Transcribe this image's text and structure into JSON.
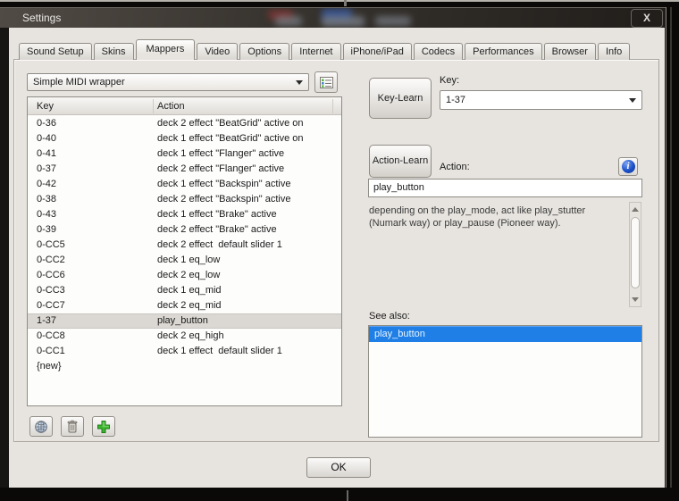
{
  "window": {
    "title": "Settings",
    "close_label": "X"
  },
  "tabs": [
    {
      "label": "Sound Setup"
    },
    {
      "label": "Skins"
    },
    {
      "label": "Mappers",
      "active": true
    },
    {
      "label": "Video"
    },
    {
      "label": "Options"
    },
    {
      "label": "Internet"
    },
    {
      "label": "iPhone/iPad"
    },
    {
      "label": "Codecs"
    },
    {
      "label": "Performances"
    },
    {
      "label": "Browser"
    },
    {
      "label": "Info"
    }
  ],
  "mapper": {
    "selected": "Simple MIDI wrapper"
  },
  "mapping_table": {
    "columns": [
      "Key",
      "Action"
    ],
    "rows": [
      {
        "key": "0-36",
        "action": "deck 2 effect \"BeatGrid\" active on"
      },
      {
        "key": "0-40",
        "action": "deck 1 effect \"BeatGrid\" active on"
      },
      {
        "key": "0-41",
        "action": "deck 1 effect \"Flanger\" active"
      },
      {
        "key": "0-37",
        "action": "deck 2 effect \"Flanger\" active"
      },
      {
        "key": "0-42",
        "action": "deck 1 effect \"Backspin\" active"
      },
      {
        "key": "0-38",
        "action": "deck 2 effect \"Backspin\" active"
      },
      {
        "key": "0-43",
        "action": "deck 1 effect \"Brake\" active"
      },
      {
        "key": "0-39",
        "action": "deck 2 effect \"Brake\" active"
      },
      {
        "key": "0-CC5",
        "action": "deck 2 effect  default slider 1"
      },
      {
        "key": "0-CC2",
        "action": "deck 1 eq_low"
      },
      {
        "key": "0-CC6",
        "action": "deck 2 eq_low"
      },
      {
        "key": "0-CC3",
        "action": "deck 1 eq_mid"
      },
      {
        "key": "0-CC7",
        "action": "deck 2 eq_mid"
      },
      {
        "key": "1-37",
        "action": "play_button",
        "selected": true
      },
      {
        "key": "0-CC8",
        "action": "deck 2 eq_high"
      },
      {
        "key": "0-CC1",
        "action": "deck 1 effect  default slider 1"
      },
      {
        "key": "{new}",
        "action": ""
      }
    ]
  },
  "toolbar_icons": [
    "globe",
    "trash",
    "add"
  ],
  "right": {
    "key_learn_label": "Key-Learn",
    "key_label": "Key:",
    "key_value": "1-37",
    "action_learn_label": "Action-Learn",
    "action_label": "Action:",
    "info_glyph": "i",
    "action_value": "play_button",
    "description": "depending on the play_mode, act like play_stutter (Numark way) or play_pause (Pioneer way).",
    "see_also_label": "See also:",
    "see_also_items": [
      {
        "label": "play_button",
        "selected": true
      }
    ]
  },
  "footer": {
    "ok_label": "OK"
  },
  "colors": {
    "selection_blue": "#1f7fe6",
    "add_green": "#3cb52e",
    "info_blue": "#1c50c8",
    "dialog_bg": "#e7e4df",
    "titlebar_dark": "#38342f"
  }
}
